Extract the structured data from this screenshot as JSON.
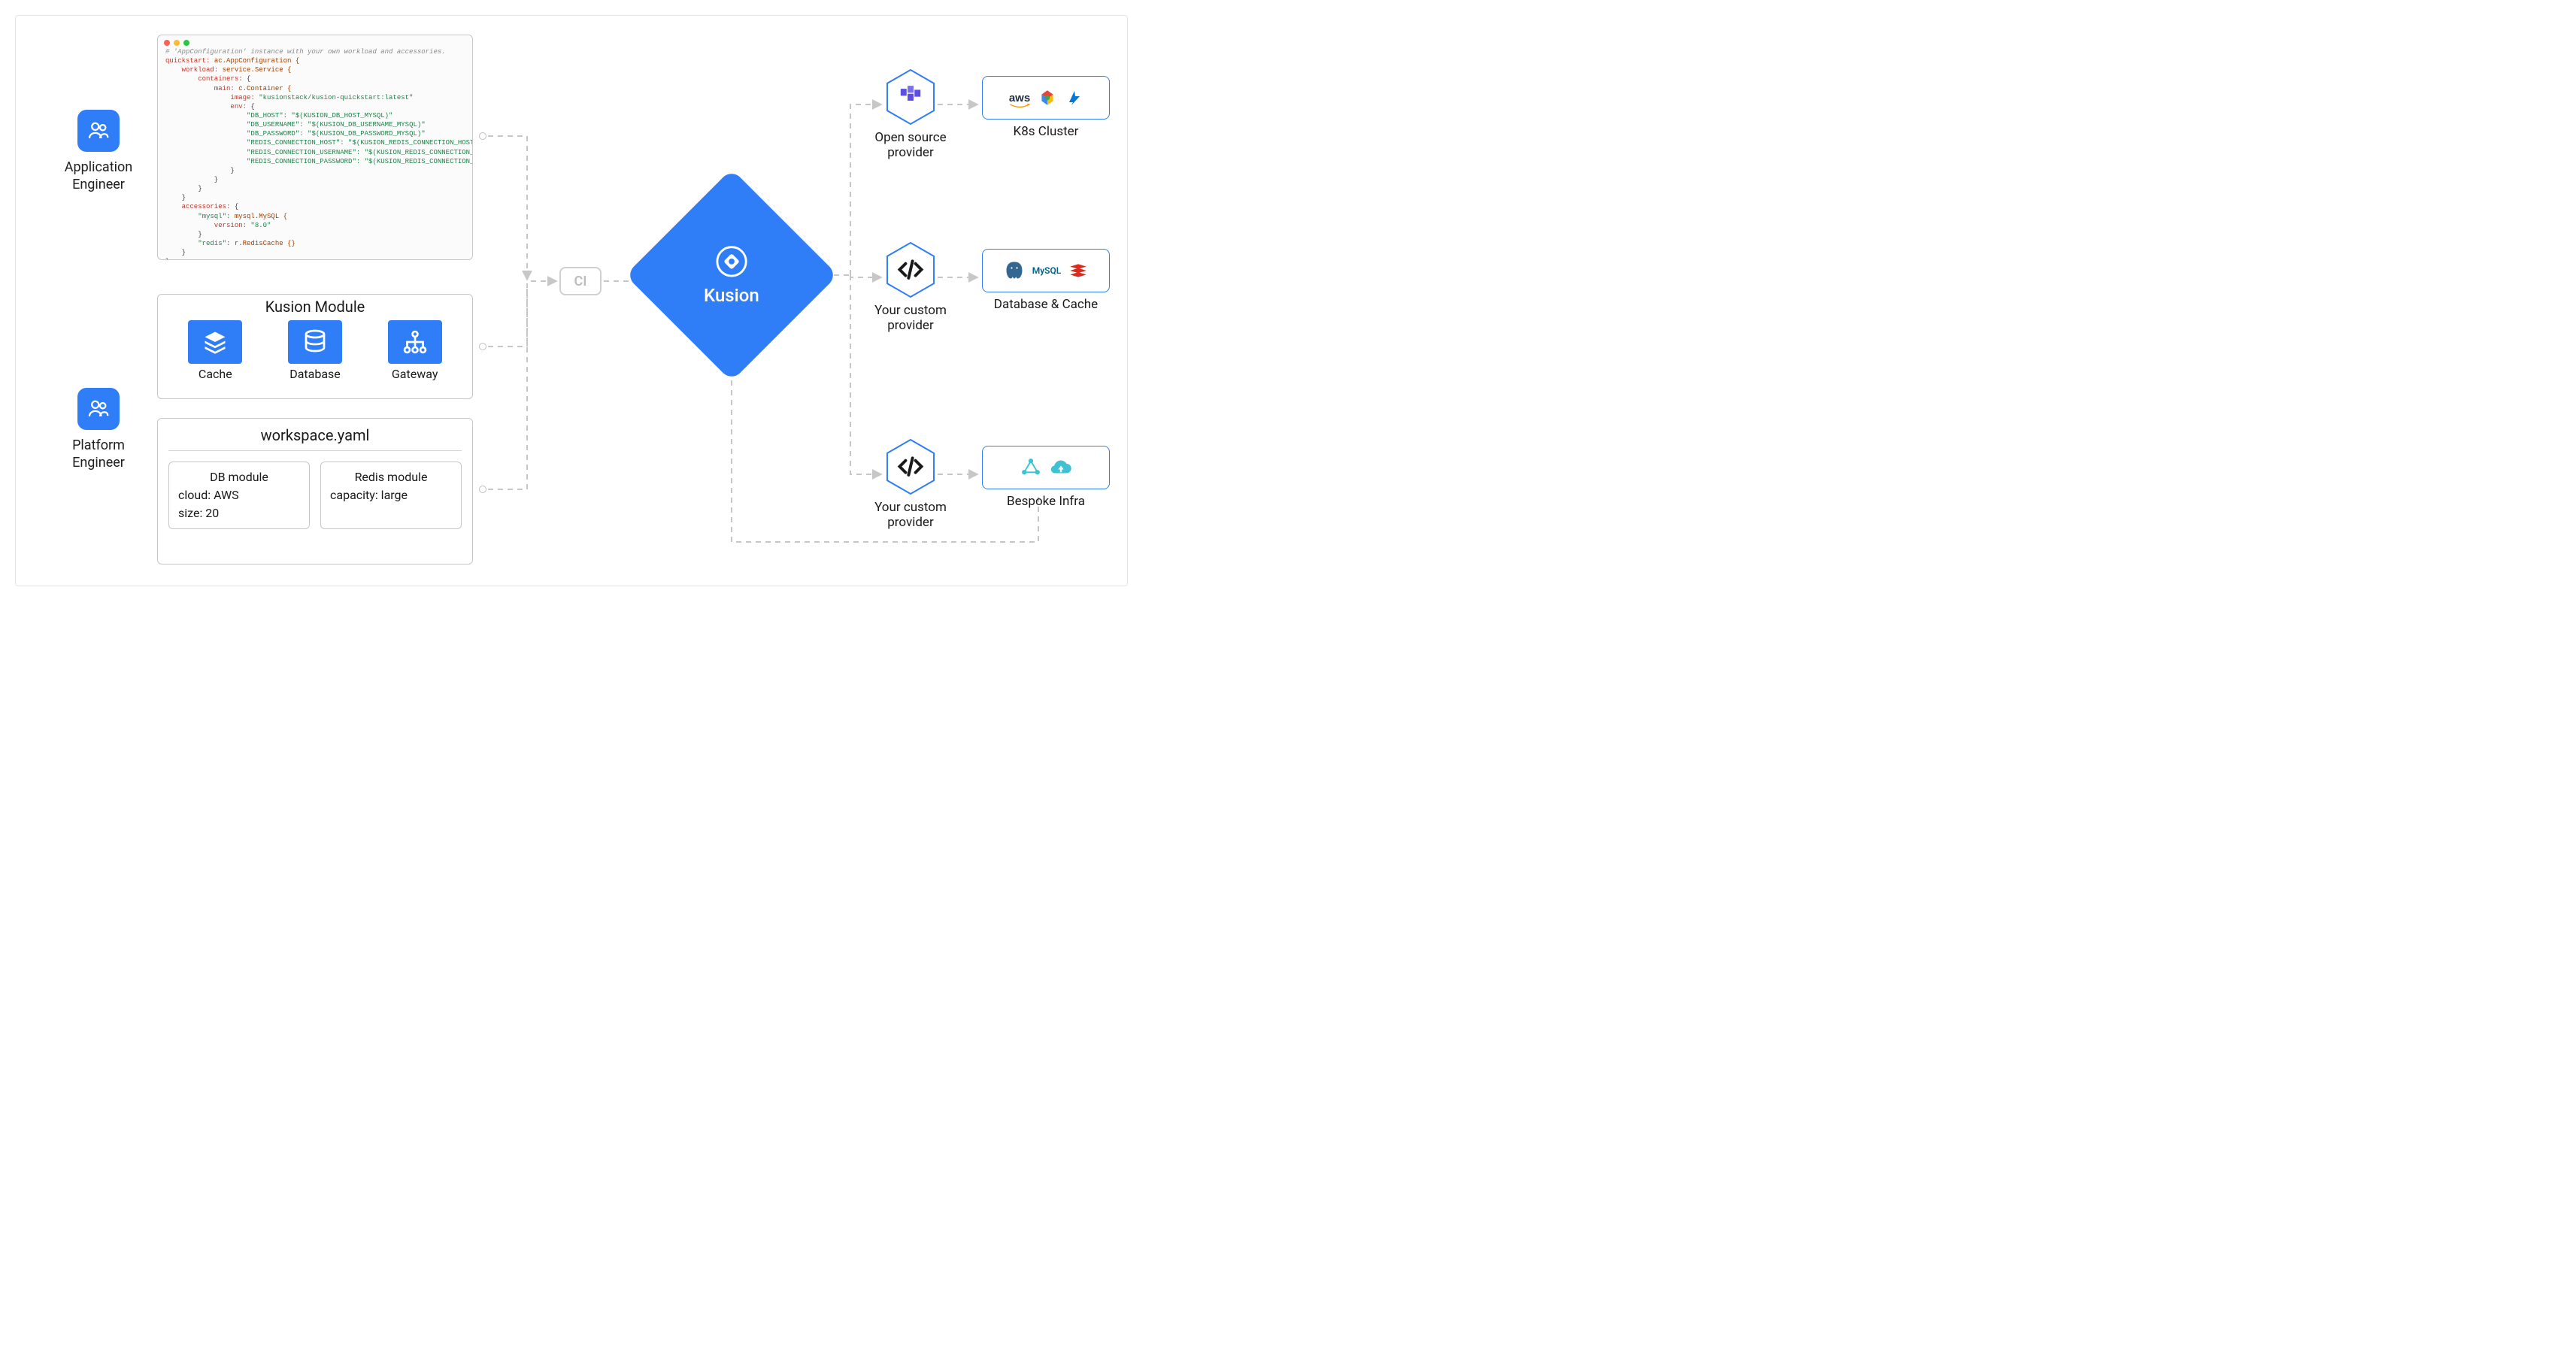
{
  "personas": {
    "app": "Application Engineer",
    "platform": "Platform Engineer"
  },
  "code": {
    "comment": "# 'AppConfiguration' instance with your own workload and accessories.",
    "lines": {
      "l1a": "quickstart:",
      "l1b": " ac.AppConfiguration {",
      "l2a": "    workload:",
      "l2b": " service.Service {",
      "l3a": "        containers:",
      "l3b": " {",
      "l4a": "            main:",
      "l4b": " c.Container {",
      "l5a": "                image:",
      "l5b": " \"kusionstack/kusion-quickstart:latest\"",
      "l6a": "                env:",
      "l6b": " {",
      "l7a": "                    \"DB_HOST\":",
      "l7b": " \"$(KUSION_DB_HOST_MYSQL)\"",
      "l8a": "                    \"DB_USERNAME\":",
      "l8b": " \"$(KUSION_DB_USERNAME_MYSQL)\"",
      "l9a": "                    \"DB_PASSWORD\":",
      "l9b": " \"$(KUSION_DB_PASSWORD_MYSQL)\"",
      "l10a": "                    \"REDIS_CONNECTION_HOST\":",
      "l10b": " \"$(KUSION_REDIS_CONNECTION_HOST)\"",
      "l11a": "                    \"REDIS_CONNECTION_USERNAME\":",
      "l11b": " \"$(KUSION_REDIS_CONNECTION_USERNAME)\"",
      "l12a": "                    \"REDIS_CONNECTION_PASSWORD\":",
      "l12b": " \"$(KUSION_REDIS_CONNECTION_PASSWORD)\"",
      "l13": "                }",
      "l14": "            }",
      "l15": "        }",
      "l16": "    }",
      "l17a": "    accessories:",
      "l17b": " {",
      "l18a": "        \"mysql\":",
      "l18b": " mysql.MySQL {",
      "l19a": "            version:",
      "l19b": " \"8.0\"",
      "l20": "        }",
      "l21a": "        \"redis\":",
      "l21b": " r.RedisCache {}",
      "l22": "    }",
      "l23": "}"
    }
  },
  "module": {
    "title": "Kusion Module",
    "items": [
      "Cache",
      "Database",
      "Gateway"
    ]
  },
  "workspace": {
    "title": "workspace.yaml",
    "db": {
      "title": "DB module",
      "l1": "cloud: AWS",
      "l2": "size: 20"
    },
    "redis": {
      "title": "Redis module",
      "l1": "capacity: large"
    }
  },
  "ci": "CI",
  "kusion": "Kusion",
  "providers": {
    "open": "Open source provider",
    "custom1": "Your custom provider",
    "custom2": "Your custom provider"
  },
  "targets": {
    "k8s": "K8s Cluster",
    "db": "Database & Cache",
    "bespoke": "Bespoke Infra",
    "logos": {
      "aws": "aws",
      "mysql": "MySQL"
    }
  }
}
